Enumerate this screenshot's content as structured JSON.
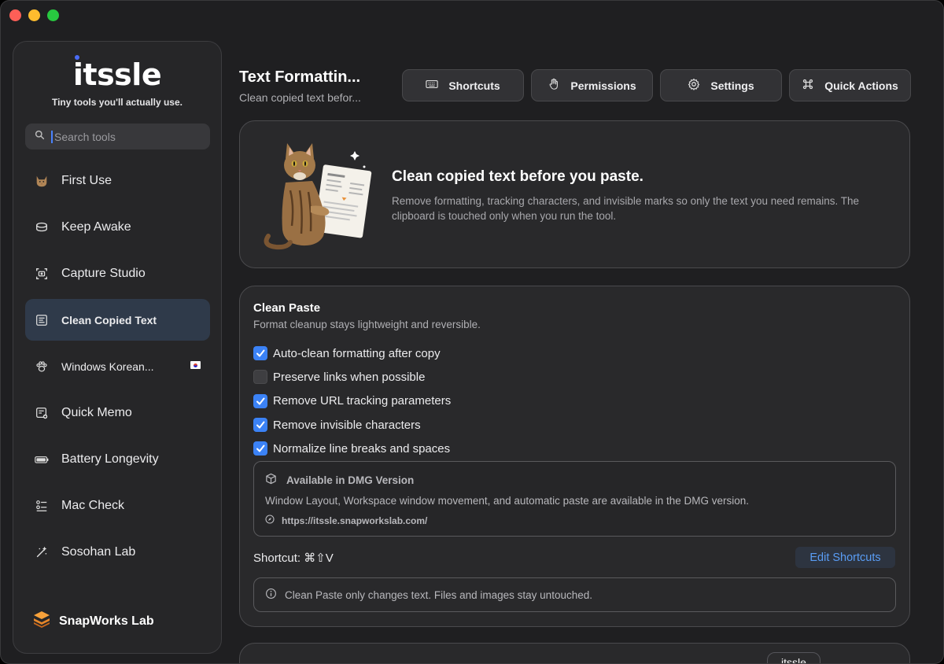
{
  "window": {
    "traffic_lights": [
      "close",
      "minimize",
      "zoom"
    ]
  },
  "sidebar": {
    "logo": "itssle",
    "tagline": "Tiny tools you'll actually use.",
    "search": {
      "placeholder": "Search tools",
      "value": ""
    },
    "items": [
      {
        "label": "First Use",
        "icon": "cat-icon",
        "active": false
      },
      {
        "label": "Keep Awake",
        "icon": "coffee-cup-icon",
        "active": false
      },
      {
        "label": "Capture Studio",
        "icon": "camera-viewfinder-icon",
        "active": false
      },
      {
        "label": "Clean Copied Text",
        "icon": "text-clean-icon",
        "active": true
      },
      {
        "label": "Windows Korean...",
        "icon": "paw-icon",
        "active": false,
        "badge": "korea-flag"
      },
      {
        "label": "Quick Memo",
        "icon": "memo-icon",
        "active": false
      },
      {
        "label": "Battery Longevity",
        "icon": "battery-icon",
        "active": false
      },
      {
        "label": "Mac Check",
        "icon": "checklist-icon",
        "active": false
      },
      {
        "label": "Sosohan Lab",
        "icon": "magic-wand-icon",
        "active": false
      }
    ],
    "brand": "SnapWorks Lab"
  },
  "header": {
    "title": "Text Formattin...",
    "subtitle": "Clean copied text befor..."
  },
  "toolbar": {
    "shortcuts": "Shortcuts",
    "permissions": "Permissions",
    "settings": "Settings",
    "quick_actions": "Quick Actions"
  },
  "hero": {
    "title": "Clean copied text before you paste.",
    "body": "Remove formatting, tracking characters, and invisible marks so only the text you need remains. The clipboard is touched only when you run the tool."
  },
  "clean_paste": {
    "title": "Clean Paste",
    "subtitle": "Format cleanup stays lightweight and reversible.",
    "options": [
      {
        "label": "Auto-clean formatting after copy",
        "checked": true
      },
      {
        "label": "Preserve links when possible",
        "checked": false
      },
      {
        "label": "Remove URL tracking parameters",
        "checked": true
      },
      {
        "label": "Remove invisible characters",
        "checked": true
      },
      {
        "label": "Normalize line breaks and spaces",
        "checked": true
      }
    ],
    "dmg": {
      "title": "Available in DMG Version",
      "body": "Window Layout, Workspace window movement, and automatic paste are available in the DMG version.",
      "link": "https://itssle.snapworkslab.com/"
    },
    "shortcut": "Shortcut: ⌘⇧V",
    "edit_shortcuts": "Edit Shortcuts",
    "note": "Clean Paste only changes text. Files and images stay untouched."
  },
  "tooltip": "itssle",
  "colors": {
    "accent": "#3b82f6",
    "link": "#5a9df5",
    "active_nav": "#2f3a4a"
  }
}
